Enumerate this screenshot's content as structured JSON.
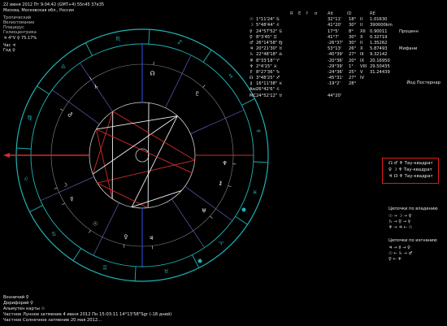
{
  "header": {
    "line1": "22 июня 2012  Пт   9:04:42 (GMT+4)  55n45  37e35",
    "line2": "Москва, Московская обл., Россия"
  },
  "left_panel": {
    "items": [
      "Тропический",
      "Велихтомание",
      "Плацидус",
      "Гелиоцентрика"
    ],
    "aspects_line": "♃ 4°V ♀ 75.17%",
    "hour_ruler": "Час ♃",
    "year_ruler": "Год ♀"
  },
  "table": {
    "header": [
      "R",
      "E",
      "f",
      "σ",
      "Alt",
      "ID",
      "RE"
    ],
    "rows": [
      {
        "p": "☉",
        "lon": "1°11'24\" ♋",
        "alt": "32°11'",
        "id": "18°",
        "ex": "II",
        "re": "1.01630"
      },
      {
        "p": "☽",
        "lon": "5°48'44\" ♌",
        "alt": "41°20'",
        "id": "30°",
        "ex": "II",
        "re": "390000km"
      },
      {
        "p": "☿",
        "lon": "24°57'52\" ♋",
        "alt": "17°5'",
        "id": "8°",
        "ex": "XII",
        "re": "0.90011",
        "note": "Проценн"
      },
      {
        "p": "♀",
        "lon": "8°3'45\" ♊",
        "alt": "41°7'",
        "id": "30°",
        "ex": "X",
        "re": "0.32719"
      },
      {
        "p": "♂",
        "lon": "26°14'58\" ♍",
        "alt": "-26°37'",
        "id": "30°",
        "ex": "II",
        "re": "1.35262"
      },
      {
        "p": "♃",
        "lon": "20°21'30\" ♉",
        "alt": "53°13'",
        "id": "26°",
        "ex": "X",
        "re": "5.87493",
        "note": "Мифани"
      },
      {
        "p": "♄",
        "lon": "22°48'18\" ♎",
        "alt": "-40°39'",
        "id": "27°",
        "ex": "III",
        "re": "9.32142"
      },
      {
        "p": "♅",
        "lon": "8°33'18\" ♈",
        "alt": "-20°36'",
        "id": "20°",
        "ex": "IX",
        "re": "20.16950"
      },
      {
        "p": "♆",
        "lon": "2°4'15\" ♓",
        "alt": "-29°39'",
        "id": "1°",
        "ex": "VIII",
        "re": "29.50435"
      },
      {
        "p": "♇",
        "lon": "8°27'36\" ♑",
        "alt": "-24°36'",
        "id": "25°",
        "ex": "V",
        "re": "31.24439"
      },
      {
        "p": "☊",
        "lon": "3°48'25\" ♐",
        "alt": "-45°31'",
        "id": "27°",
        "ex": "IV",
        "re": ""
      },
      {
        "p": "⚷",
        "lon": "16°11'38\" ♓",
        "alt": "-19°2'",
        "id": "28°",
        "ex": "",
        "re": ""
      },
      {
        "p": "Asc",
        "lon": "26°42'6\" ♌",
        "alt": "",
        "id": "",
        "ex": "",
        "re": ""
      },
      {
        "p": "MC",
        "lon": "24°52'12\" ♉",
        "alt": "44°20'",
        "id": "",
        "ex": "",
        "re": ""
      }
    ],
    "yod_note": "Йод Постернар"
  },
  "tau": {
    "rows": [
      {
        "sym": "☊ ♂ ♆",
        "label": "Тау-квадрат"
      },
      {
        "sym": "♀ ☽ ♆",
        "label": "Тау-квадрат"
      },
      {
        "sym": "♃ ☊ ♆",
        "label": "Тау-квадрат"
      }
    ]
  },
  "chains": {
    "rulership_title": "Цепочки по владению",
    "exaltation_title": "Цепочки по изгнанию",
    "rulership": [
      "☉ → ☽ → ♀",
      "♄ → ♀ → ☿",
      "♆ → ♃ ← ☉"
    ],
    "exaltation": [
      "♃ → ☿ → ♀",
      "☉ ← ♄ → ♂",
      "♀ ← ♆"
    ]
  },
  "footer": {
    "l1": "Возничий ♀",
    "l2": "Дорифорий ♀",
    "l3": "Альмутен карты ☉",
    "l4": "Частное Лунное затмение 4 июня 2012 Пн 15:03:11 14°13'58\"Sgr (-18 дней)",
    "l5": "Частное Солнечное затмение 20 мая 2012..."
  },
  "chart": {
    "signs": [
      "♈",
      "♉",
      "♊",
      "♋",
      "♌",
      "♍",
      "♎",
      "♏",
      "♐",
      "♑",
      "♒",
      "♓"
    ],
    "asc_deg": 146.7,
    "planets": [
      {
        "glyph": "☉",
        "lon": 91.2
      },
      {
        "glyph": "☽",
        "lon": 125.8
      },
      {
        "glyph": "☿",
        "lon": 115.0
      },
      {
        "glyph": "♀",
        "lon": 68.1
      },
      {
        "glyph": "♂",
        "lon": 176.2
      },
      {
        "glyph": "♃",
        "lon": 50.4
      },
      {
        "glyph": "♄",
        "lon": 202.8
      },
      {
        "glyph": "♅",
        "lon": 8.6
      },
      {
        "glyph": "♆",
        "lon": 332.1
      },
      {
        "glyph": "♇",
        "lon": 278.5
      },
      {
        "glyph": "☊",
        "lon": 243.8
      },
      {
        "glyph": "⚷",
        "lon": 346.2
      }
    ],
    "colors": {
      "ring": "#1fb3b3",
      "red": "#d42b2b",
      "white": "#f0f0f0",
      "blue": "#2e4bd8"
    }
  }
}
